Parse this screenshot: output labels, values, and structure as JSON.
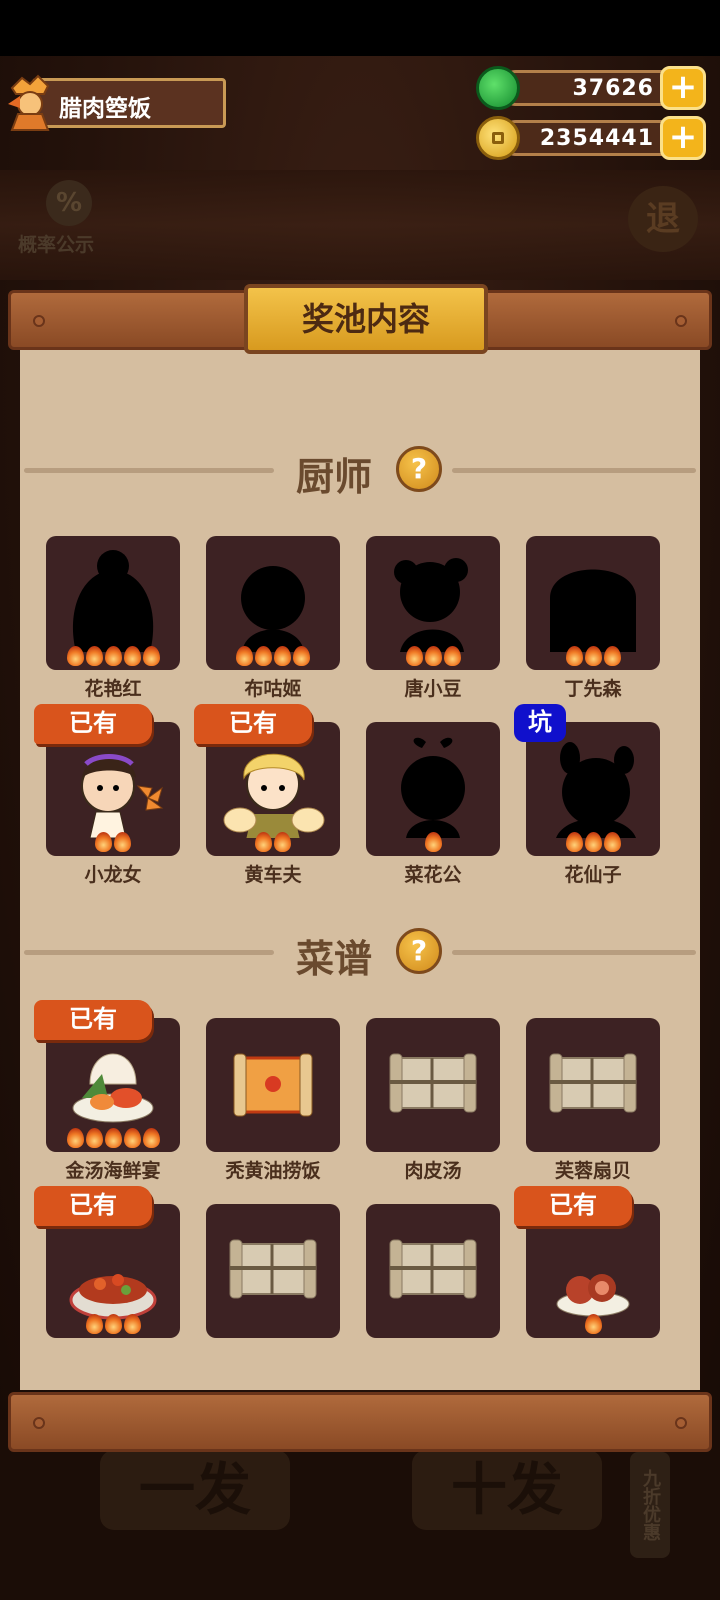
{
  "profile": {
    "dish_name": "腊肉箜饭"
  },
  "currency": [
    {
      "icon": "jade-icon",
      "value": "37626"
    },
    {
      "icon": "coin-icon",
      "value": "2354441"
    }
  ],
  "background": {
    "probability_label": "概率公示",
    "exit_label": "退",
    "single_draw": "一发",
    "ten_draw": "十发",
    "discount": "九折优惠"
  },
  "modal": {
    "title": "奖池内容"
  },
  "sections": {
    "chefs": {
      "label": "厨师",
      "help": "?"
    },
    "recipes": {
      "label": "菜谱",
      "help": "?"
    }
  },
  "chefs": [
    {
      "name": "花艳红",
      "stars": 5,
      "owned": false,
      "revealed": false
    },
    {
      "name": "布咕姬",
      "stars": 4,
      "owned": false,
      "revealed": false
    },
    {
      "name": "唐小豆",
      "stars": 3,
      "owned": false,
      "revealed": false
    },
    {
      "name": "丁先森",
      "stars": 3,
      "owned": false,
      "revealed": false
    },
    {
      "name": "小龙女",
      "stars": 2,
      "owned": true,
      "revealed": true
    },
    {
      "name": "黄车夫",
      "stars": 2,
      "owned": true,
      "revealed": true
    },
    {
      "name": "菜花公",
      "stars": 1,
      "owned": false,
      "revealed": false
    },
    {
      "name": "花仙子",
      "stars": 3,
      "owned": false,
      "revealed": false,
      "tag": "坑"
    }
  ],
  "recipes": [
    {
      "name": "金汤海鲜宴",
      "stars": 5,
      "owned": true
    },
    {
      "name": "秃黄油捞饭",
      "stars": 0,
      "owned": false
    },
    {
      "name": "肉皮汤",
      "stars": 0,
      "owned": false
    },
    {
      "name": "芙蓉扇贝",
      "stars": 0,
      "owned": false
    },
    {
      "name": "",
      "stars": 3,
      "owned": true
    },
    {
      "name": "",
      "stars": 0,
      "owned": false
    },
    {
      "name": "",
      "stars": 0,
      "owned": false
    },
    {
      "name": "",
      "stars": 1,
      "owned": true
    }
  ],
  "owned_label": "已有",
  "colors": {
    "accent": "#f3b41b",
    "owned_badge": "#d9541c",
    "tag_badge": "#1010cc",
    "panel": "#d5bea0",
    "card": "#3d2223"
  }
}
